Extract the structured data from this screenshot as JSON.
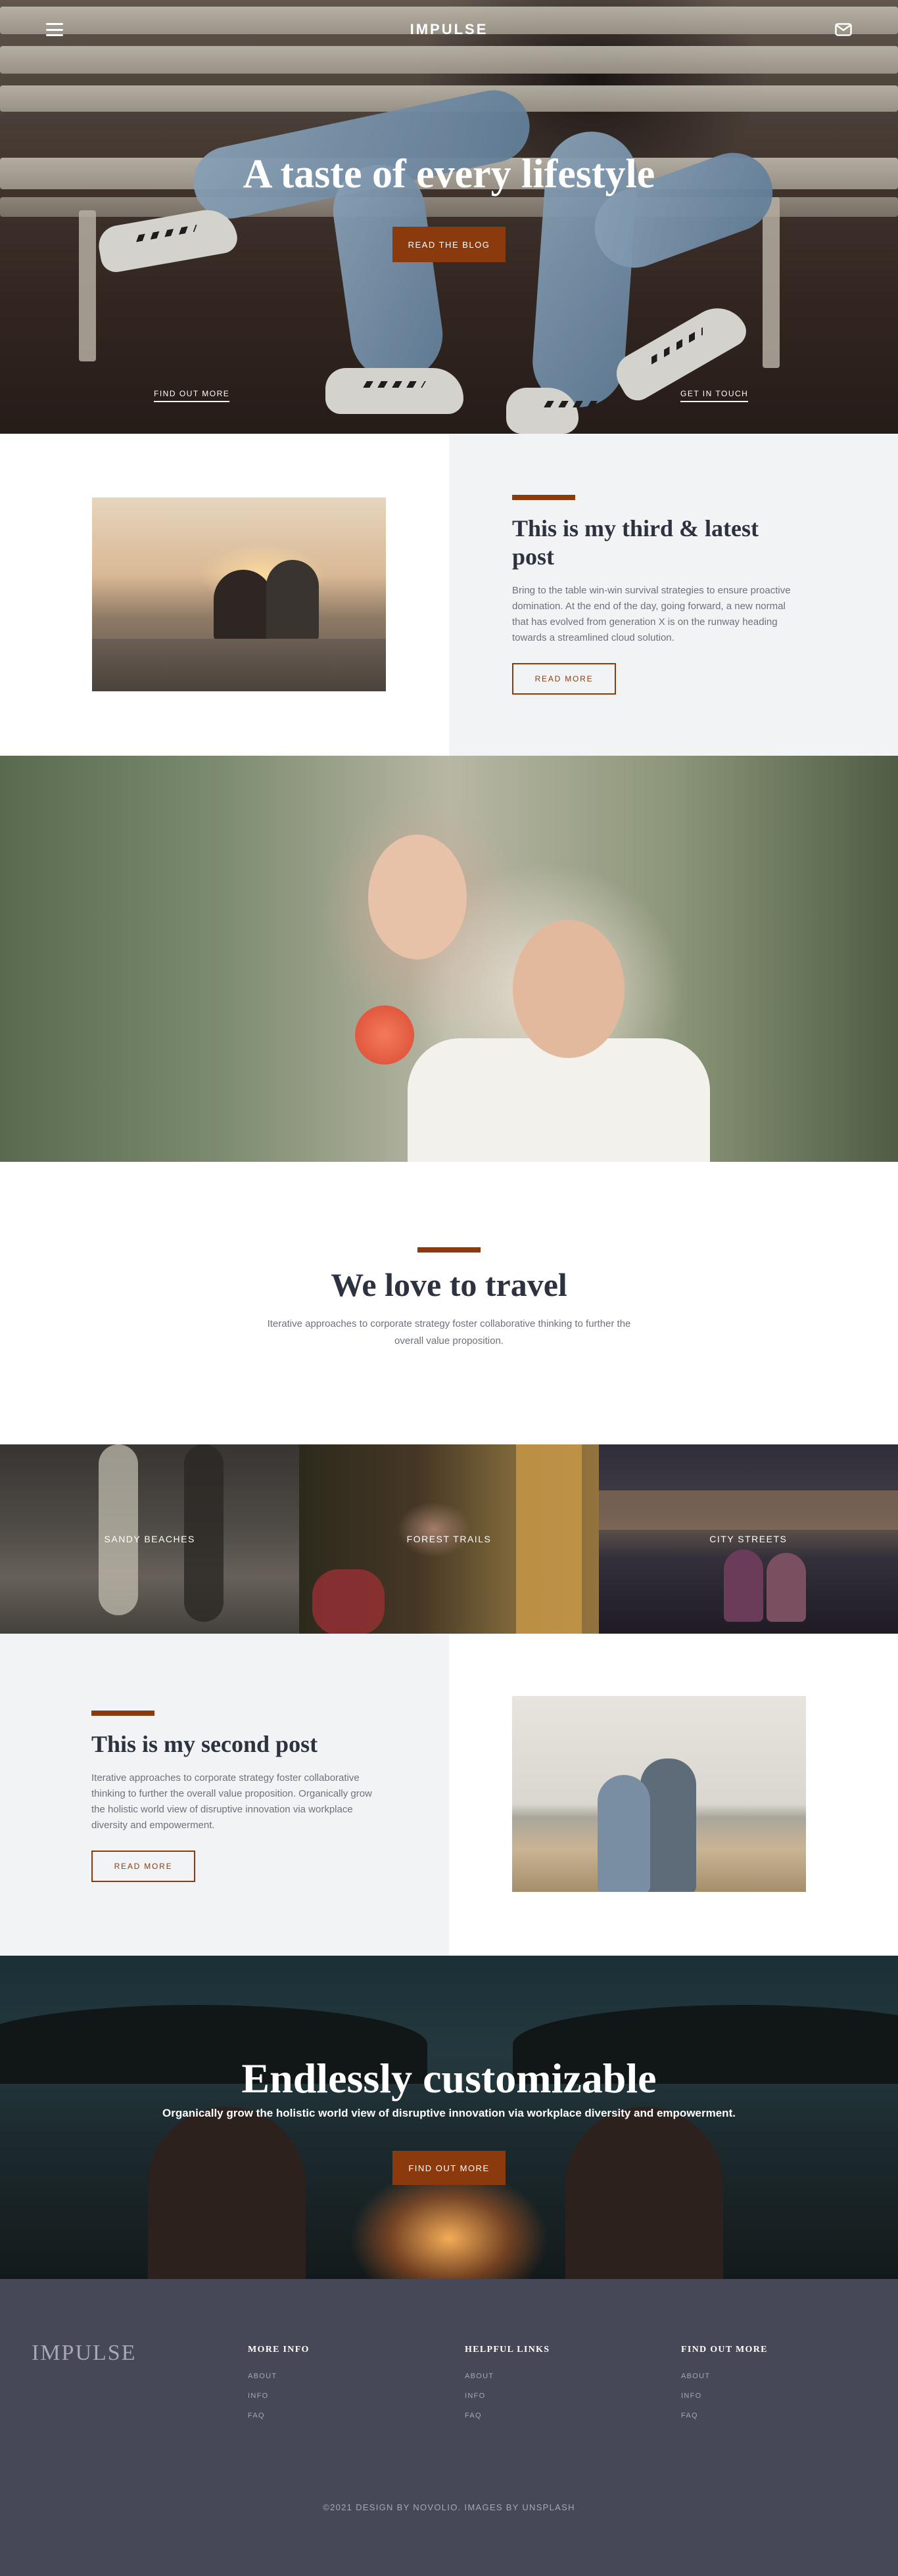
{
  "header": {
    "brand": "IMPULSE",
    "menu_icon": "hamburger-menu-icon",
    "mail_icon": "mail-icon"
  },
  "hero": {
    "title": "A taste of every lifestyle",
    "button_label": "READ THE BLOG",
    "link_left": "FIND OUT MORE",
    "link_right": "GET IN TOUCH"
  },
  "post_latest": {
    "title": "This is my third & latest post",
    "body": "Bring to the table win-win survival strategies to ensure proactive domination. At the end of the day, going forward, a new normal that has evolved from generation X is on the runway heading towards a streamlined cloud solution.",
    "button_label": "READ MORE"
  },
  "travel": {
    "title": "We love to travel",
    "subtitle": "Iterative approaches to corporate strategy foster collaborative thinking to further the overall value proposition."
  },
  "tiles": [
    {
      "label": "SANDY BEACHES"
    },
    {
      "label": "FOREST TRAILS"
    },
    {
      "label": "CITY STREETS"
    }
  ],
  "post_second": {
    "title": "This is my second post",
    "body": "Iterative approaches to corporate strategy foster collaborative thinking to further the overall value proposition. Organically grow the holistic world view of disruptive innovation via workplace diversity and empowerment.",
    "button_label": "READ MORE"
  },
  "cta": {
    "title": "Endlessly customizable",
    "subtitle": "Organically grow the holistic world view of disruptive innovation via workplace diversity and empowerment.",
    "button_label": "FIND OUT MORE"
  },
  "footer": {
    "brand": "IMPULSE",
    "columns": [
      {
        "heading": "MORE INFO",
        "links": [
          "ABOUT",
          "INFO",
          "FAQ"
        ]
      },
      {
        "heading": "HELPFUL LINKS",
        "links": [
          "ABOUT",
          "INFO",
          "FAQ"
        ]
      },
      {
        "heading": "FIND OUT MORE",
        "links": [
          "ABOUT",
          "INFO",
          "FAQ"
        ]
      }
    ],
    "copyright": "©2021 DESIGN BY NOVOLIO. IMAGES BY UNSPLASH"
  },
  "colors": {
    "accent": "#8b3a0e",
    "heading": "#2d3240",
    "light_grey_bg": "#f2f3f4",
    "footer_bg": "#464757"
  }
}
